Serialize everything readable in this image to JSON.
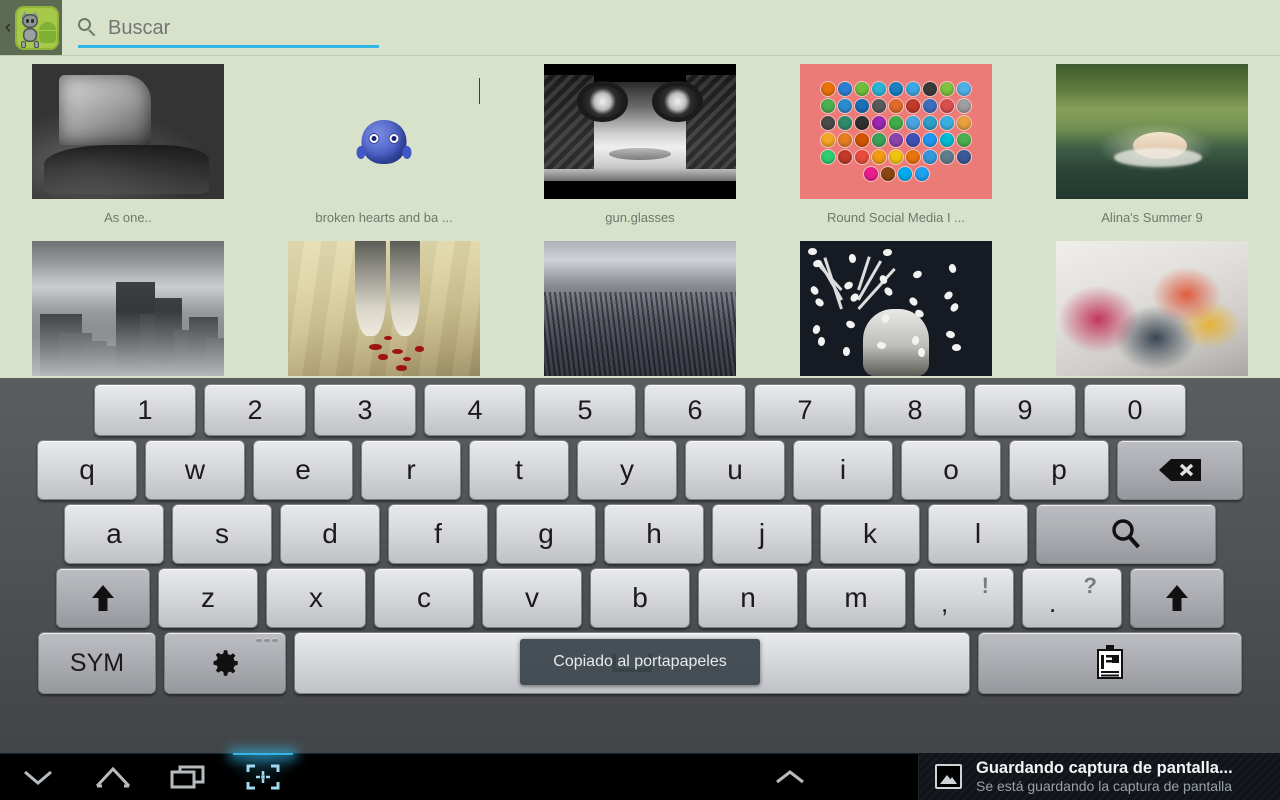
{
  "app": {
    "icon_name": "android-robot-cat-app-icon",
    "back_caret": "‹"
  },
  "search": {
    "placeholder": "Buscar",
    "value": "",
    "icon": "search-icon",
    "underline_color": "#33b5e5"
  },
  "gallery": {
    "background_color": "#d8e2ca",
    "rows": [
      [
        {
          "caption": "As one..",
          "art": "t-bus"
        },
        {
          "caption": "broken hearts and ba ...",
          "art": "t-broken"
        },
        {
          "caption": "gun.glasses",
          "art": "t-face"
        },
        {
          "caption": "Round Social Media I ...",
          "art": "t-social"
        },
        {
          "caption": "Alina's Summer 9",
          "art": "t-alina"
        }
      ],
      [
        {
          "caption": "",
          "art": "t-city"
        },
        {
          "caption": "",
          "art": "t-feet"
        },
        {
          "caption": "",
          "art": "t-grass"
        },
        {
          "caption": "",
          "art": "t-deer"
        },
        {
          "caption": "",
          "art": "t-abstract"
        }
      ]
    ]
  },
  "keyboard": {
    "rows": {
      "numbers": [
        "1",
        "2",
        "3",
        "4",
        "5",
        "6",
        "7",
        "8",
        "9",
        "0"
      ],
      "top": [
        "q",
        "w",
        "e",
        "r",
        "t",
        "y",
        "u",
        "i",
        "o",
        "p"
      ],
      "home": [
        "a",
        "s",
        "d",
        "f",
        "g",
        "h",
        "j",
        "k",
        "l"
      ],
      "bottom": [
        "z",
        "x",
        "c",
        "v",
        "b",
        "n",
        "m"
      ]
    },
    "backspace_label": "backspace-icon",
    "enter_label": "search-icon",
    "shift_left_label": "shift-icon",
    "shift_right_label": "shift-icon",
    "comma_main": ",",
    "comma_sup": "!",
    "period_main": ".",
    "period_sup": "?",
    "sym_label": "SYM",
    "settings_label": "gear-icon",
    "space_label": "space-icon",
    "clipboard_label": "clipboard-icon"
  },
  "toast": {
    "message": "Copiado al portapapeles"
  },
  "navbar": {
    "buttons": [
      {
        "name": "hide-keyboard-button",
        "icon": "chevron-down-icon",
        "active": false
      },
      {
        "name": "home-button",
        "icon": "home-icon",
        "active": false
      },
      {
        "name": "recents-button",
        "icon": "recents-icon",
        "active": false
      },
      {
        "name": "screenshot-button",
        "icon": "screenshot-icon",
        "active": true
      }
    ],
    "center_handle_icon": "chevron-up-icon",
    "accent_color": "#33b5e5"
  },
  "notification": {
    "icon": "image-icon",
    "title": "Guardando captura de pantalla...",
    "subtitle": "Se está guardando la captura de pantalla"
  }
}
